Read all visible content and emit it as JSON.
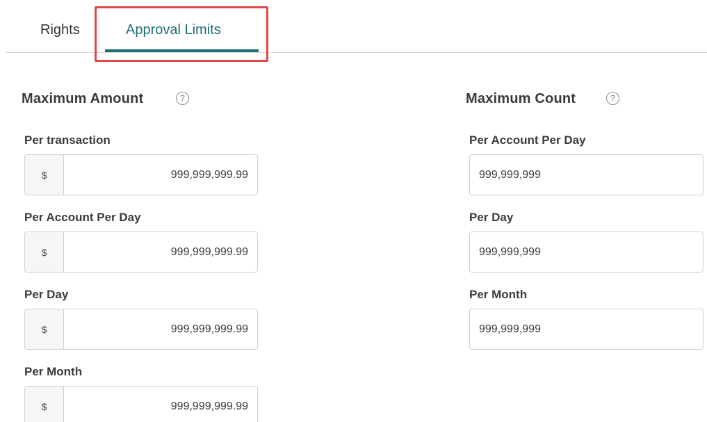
{
  "tabs": {
    "rights_label": "Rights",
    "approval_limits_label": "Approval Limits",
    "active": "Approval Limits"
  },
  "colors": {
    "accent": "#1c6f74",
    "highlight": "#e04848"
  },
  "help_icon_glyph": "?",
  "max_amount": {
    "title": "Maximum Amount",
    "currency_symbol": "$",
    "fields": [
      {
        "label": "Per transaction",
        "value": "999,999,999.99"
      },
      {
        "label": "Per Account Per Day",
        "value": "999,999,999.99"
      },
      {
        "label": "Per Day",
        "value": "999,999,999.99"
      },
      {
        "label": "Per Month",
        "value": "999,999,999.99"
      }
    ]
  },
  "max_count": {
    "title": "Maximum Count",
    "fields": [
      {
        "label": "Per Account Per Day",
        "value": "999,999,999"
      },
      {
        "label": "Per Day",
        "value": "999,999,999"
      },
      {
        "label": "Per Month",
        "value": "999,999,999"
      }
    ]
  }
}
